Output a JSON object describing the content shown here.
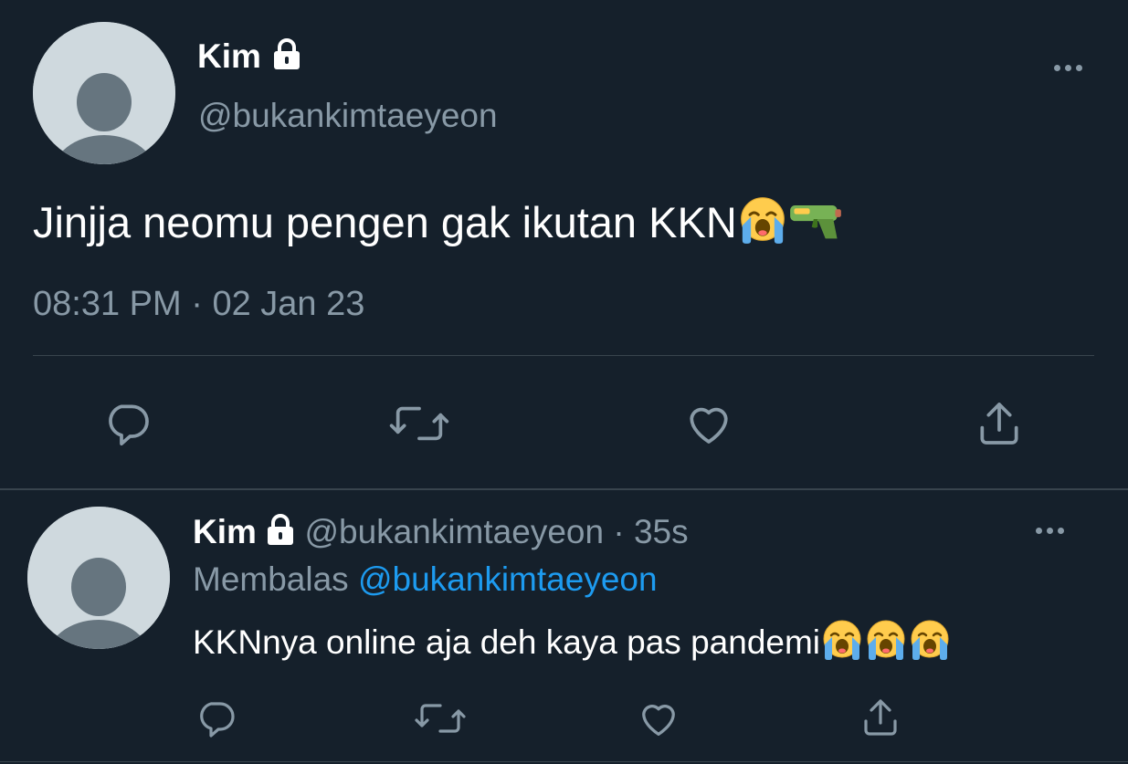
{
  "main_tweet": {
    "display_name": "Kim",
    "handle": "@bukankimtaeyeon",
    "text": "Jinjja neomu pengen gak ikutan KKN",
    "emojis": [
      "loudly-crying-face-icon",
      "water-pistol-icon"
    ],
    "time": "08:31 PM",
    "separator": "·",
    "date": "02 Jan 23",
    "actions": [
      "reply-icon",
      "retweet-icon",
      "like-icon",
      "share-icon"
    ]
  },
  "reply_tweet": {
    "display_name": "Kim",
    "handle": "@bukankimtaeyeon",
    "separator": "·",
    "age": "35s",
    "replying_label": "Membalas",
    "replying_to": "@bukankimtaeyeon",
    "text": "KKNnya online aja deh kaya pas pandemi",
    "emojis": [
      "loudly-crying-face-icon",
      "loudly-crying-face-icon",
      "loudly-crying-face-icon"
    ],
    "actions": [
      "reply-icon",
      "retweet-icon",
      "like-icon",
      "share-icon"
    ]
  },
  "colors": {
    "background": "#15202b",
    "text": "#ffffff",
    "muted": "#8899a6",
    "link": "#1d9bf0",
    "divider": "#38444d"
  }
}
